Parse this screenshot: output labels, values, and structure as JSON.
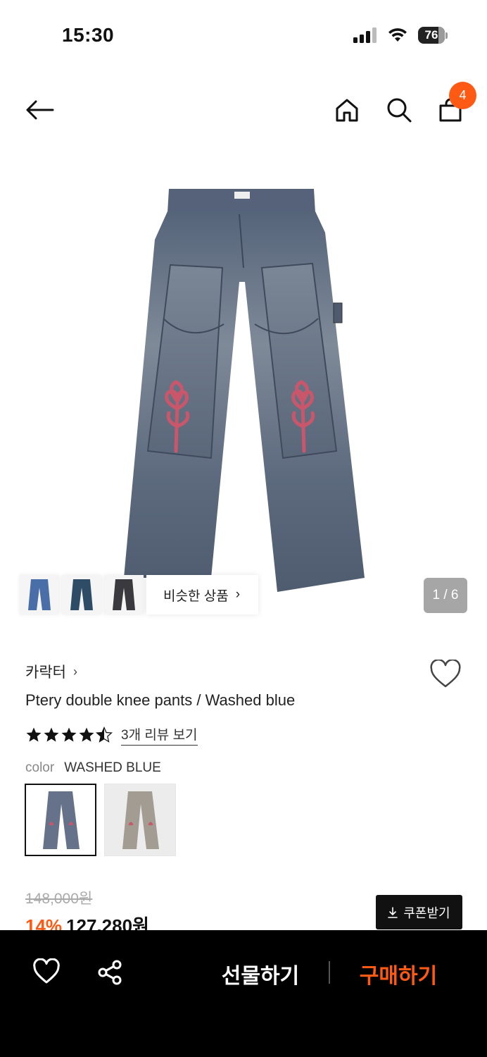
{
  "status_bar": {
    "time": "15:30",
    "battery": "76"
  },
  "nav": {
    "cart_count": "4",
    "icons": [
      "back-arrow-icon",
      "home-icon",
      "search-icon",
      "shopping-bag-icon"
    ]
  },
  "gallery": {
    "page_indicator": "1 / 6",
    "similar_label": "비슷한 상품",
    "similar_chevron": "›"
  },
  "product": {
    "brand": "카락터",
    "brand_chevron": "›",
    "title": "Ptery double knee pants / Washed blue",
    "rating": 4.5,
    "review_link": "3개 리뷰 보기",
    "color_label": "color",
    "color_value": "WASHED BLUE",
    "original_price": "148,000원",
    "discount": "14%",
    "price": "127,280원",
    "coupon_label": "쿠폰받기"
  },
  "bottom_bar": {
    "gift_label": "선물하기",
    "buy_label": "구매하기"
  },
  "colors": {
    "accent": "#ff5a14",
    "denim": "#5f6d80",
    "bottom_bar": "#000000"
  }
}
